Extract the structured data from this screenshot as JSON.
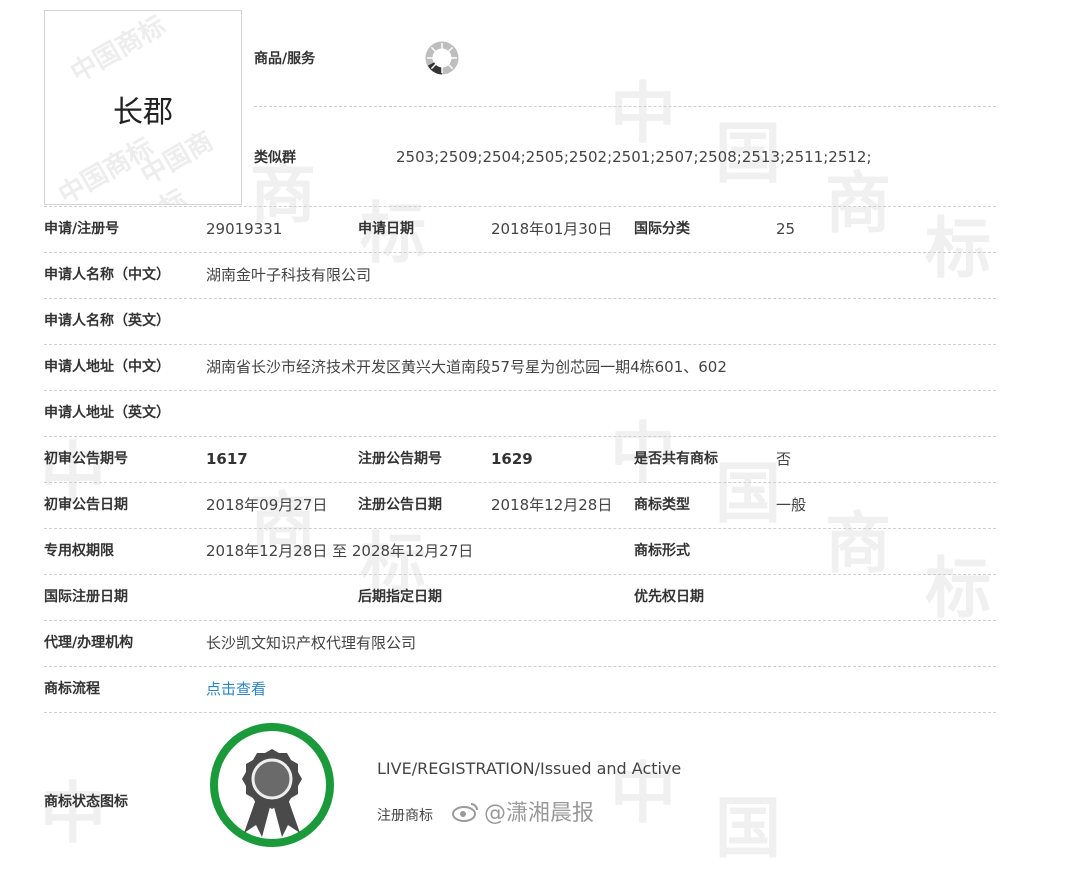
{
  "mark": {
    "name": "长郡",
    "watermark": "中国商标"
  },
  "goods": {
    "label": "商品/服务"
  },
  "similar": {
    "label": "类似群",
    "value": "2503;2509;2504;2505;2502;2501;2507;2508;2513;2511;2512;"
  },
  "rows": [
    {
      "c1": "申请/注册号",
      "c2": "29019331",
      "c3": "申请日期",
      "c4": "2018年01月30日",
      "c5": "国际分类",
      "c6": "25"
    },
    {
      "c1": "申请人名称（中文）",
      "c2": "湖南金叶子科技有限公司"
    },
    {
      "c1": "申请人名称（英文）"
    },
    {
      "c1": "申请人地址（中文）",
      "c2": "湖南省长沙市经济技术开发区黄兴大道南段57号星为创芯园一期4栋601、602"
    },
    {
      "c1": "申请人地址（英文）"
    },
    {
      "c1": "初审公告期号",
      "c2": "1617",
      "c3": "注册公告期号",
      "c4": "1629",
      "c5": "是否共有商标",
      "c6": "否"
    },
    {
      "c1": "初审公告日期",
      "c2": "2018年09月27日",
      "c3": "注册公告日期",
      "c4": "2018年12月28日",
      "c5": "商标类型",
      "c6": "一般"
    },
    {
      "c1": "专用权期限",
      "c2": "2018年12月28日 至 2028年12月27日",
      "c5": "商标形式"
    },
    {
      "c1": "国际注册日期",
      "c3": "后期指定日期",
      "c5": "优先权日期"
    },
    {
      "c1": "代理/办理机构",
      "c2": "长沙凯文知识产权代理有限公司"
    },
    {
      "c1": "商标流程",
      "link": "点击查看"
    }
  ],
  "status": {
    "label": "商标状态图标",
    "en": "LIVE/REGISTRATION/Issued and Active",
    "cn": "注册商标",
    "ring_color": "#1a9a3a"
  },
  "weibo": {
    "text": "@潇湘晨报"
  },
  "colors": {
    "link": "#2a86c8",
    "divider": "#cfcfcf"
  }
}
